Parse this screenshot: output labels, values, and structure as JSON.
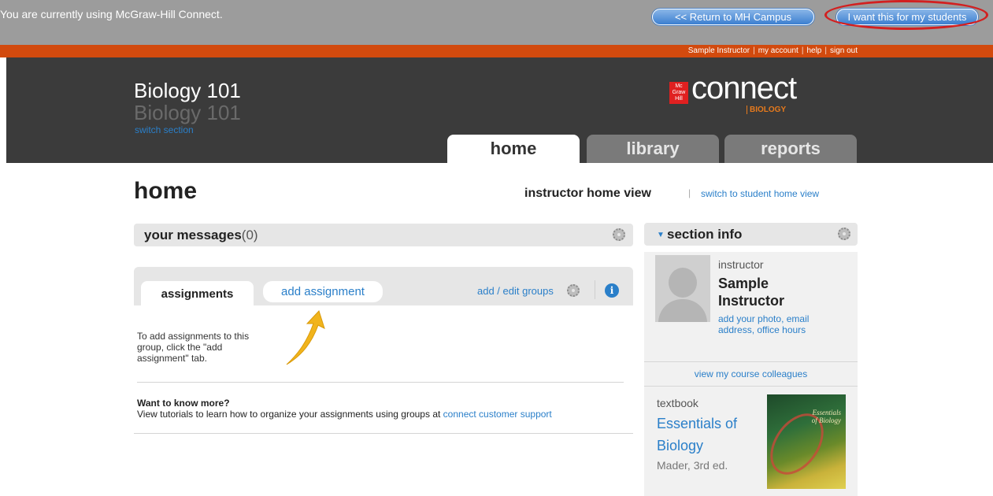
{
  "topbar": {
    "notice": "You are currently using McGraw-Hill Connect.",
    "return_label": "<< Return to MH Campus",
    "want_label": "I want this for my students"
  },
  "userlinks": {
    "name": "Sample Instructor",
    "account": "my account",
    "help": "help",
    "signout": "sign out",
    "separator": "|"
  },
  "header": {
    "course_title": "Biology 101",
    "course_subtitle": "Biology 101",
    "switch_section": "switch section",
    "logo_text": "connect",
    "logo_sub": "BIOLOGY",
    "logo_badge": "Mc Graw Hill"
  },
  "tabs": [
    {
      "label": "home"
    },
    {
      "label": "library"
    },
    {
      "label": "reports"
    }
  ],
  "main": {
    "title": "home",
    "view_label": "instructor home view",
    "view_separator": "|",
    "switch_view": "switch to student home view",
    "messages_label": "your messages",
    "messages_count": "(0)",
    "assign_tab": "assignments",
    "add_assign_tab": "add assignment",
    "add_edit_groups": "add / edit groups",
    "info_glyph": "i",
    "assign_help": "To add assignments to this group, click the \"add assignment\" tab.",
    "know_title": "Want to know more?",
    "know_text": "View tutorials to learn how to organize your assignments using groups at ",
    "know_link": "connect customer support"
  },
  "sidebar": {
    "title": "section info",
    "role": "instructor",
    "name": "Sample Instructor",
    "links": "add your photo, email address, office hours",
    "colleagues": "view my course colleagues",
    "textbook_label": "textbook",
    "textbook_title": "Essentials of Biology",
    "textbook_author": "Mader, 3rd ed.",
    "cover_text": "Essentials of Biology"
  },
  "colors": {
    "accent_blue": "#2a7fc9",
    "header_dark": "#3b3b3b",
    "orange_bar": "#d24a0e",
    "highlight_red": "#d22020"
  }
}
